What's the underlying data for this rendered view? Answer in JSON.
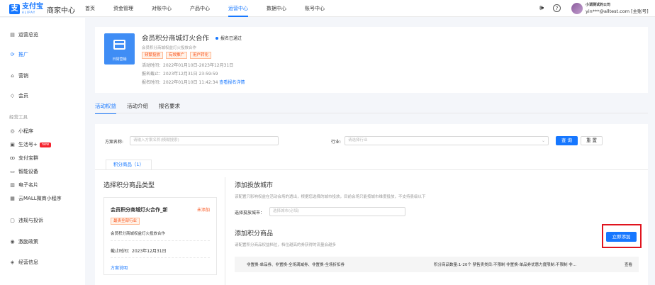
{
  "header": {
    "logo_glyph": "支",
    "logo_cn": "支付宝",
    "logo_en": "ALIPAY",
    "merchant_center": "商家中心",
    "nav": [
      {
        "label": "首页"
      },
      {
        "label": "资金管理"
      },
      {
        "label": "对账中心"
      },
      {
        "label": "产品中心"
      },
      {
        "label": "运营中心",
        "active": true
      },
      {
        "label": "数据中心"
      },
      {
        "label": "账号中心"
      }
    ],
    "icons": [
      "speaker-icon",
      "help-icon"
    ],
    "user": {
      "company": "小调测试的公司",
      "account": "yin***@alltest.com [主账号]"
    }
  },
  "sidebar": {
    "items": [
      {
        "label": "运营总览",
        "icon": "overview-icon"
      },
      {
        "label": "推广",
        "icon": "promote-icon",
        "active": true
      },
      {
        "label": "营销",
        "icon": "marketing-icon"
      },
      {
        "label": "会员",
        "icon": "member-icon"
      }
    ],
    "group_label": "经营工具",
    "tools": [
      {
        "label": "小程序",
        "icon": "miniapp-icon"
      },
      {
        "label": "生活号+",
        "icon": "lifeaccount-icon",
        "badge": "new"
      },
      {
        "label": "支付宝群",
        "icon": "group-icon"
      },
      {
        "label": "智能设备",
        "icon": "device-icon"
      },
      {
        "label": "电子名片",
        "icon": "card-icon"
      },
      {
        "label": "云MALL微商小程序",
        "icon": "mall-icon"
      },
      {
        "label": "违规与投诉",
        "icon": "complaint-icon"
      },
      {
        "label": "激励政策",
        "icon": "incentive-icon"
      },
      {
        "label": "经营信息",
        "icon": "info-icon"
      }
    ]
  },
  "activity": {
    "image_label": "日常营销",
    "title": "会员积分商城灯火合作",
    "status": "报名已通过",
    "subtitle": "会员积分商城权益灯火投放合作",
    "tags": [
      "频繁投放",
      "有效推广",
      "用户转化"
    ],
    "period": "活动时间：2022年01月10日-2023年12月31日",
    "deadline": "报名截止：2023年12月31日 23:59:59",
    "signup_time": "报名时间：2022年01月10日 11:42:34",
    "detail_link": "查看报名详情"
  },
  "tabs": [
    {
      "label": "活动权益",
      "active": true
    },
    {
      "label": "活动介绍"
    },
    {
      "label": "报名要求"
    }
  ],
  "filter": {
    "name_label": "方案名称:",
    "name_placeholder": "请输入方案名称(模糊搜索)",
    "industry_label": "行业:",
    "industry_placeholder": "请选择行业",
    "search_btn": "查 询",
    "reset_btn": "重 置"
  },
  "subtab": "积分商品（1）",
  "left_section": {
    "title": "选择积分商品类型",
    "card": {
      "title": "会员积分商城灯火合作_新",
      "status": "未添加",
      "tag": "最贵全部行业",
      "desc": "会员积分商城权益灯火投放合作",
      "deadline": "截止时间：2023年12月31日",
      "link": "方案说明"
    }
  },
  "right_section": {
    "city_title": "添加投放城市",
    "city_desc": "该配置只影响权益在活动会场的透出，根据您选择的城市投放，目前会场只能按城市维度投放，不支持县级以下",
    "city_label": "选择投放城市：",
    "city_placeholder": "选择城市(必填)",
    "goods_title": "添加积分商品",
    "goods_desc": "请配置积分商品权益档位，档位越高的券获得的流量会越多",
    "add_btn": "立即添加",
    "row_left": "非置换-单品券、非置换-全场满减券、非置换-全场折扣券",
    "row_mid": "积分商品数量:1-20个 禁售卖类目:不限制 非置换-单品券优惠力度限制:不限制 非...",
    "row_link": "查看"
  }
}
